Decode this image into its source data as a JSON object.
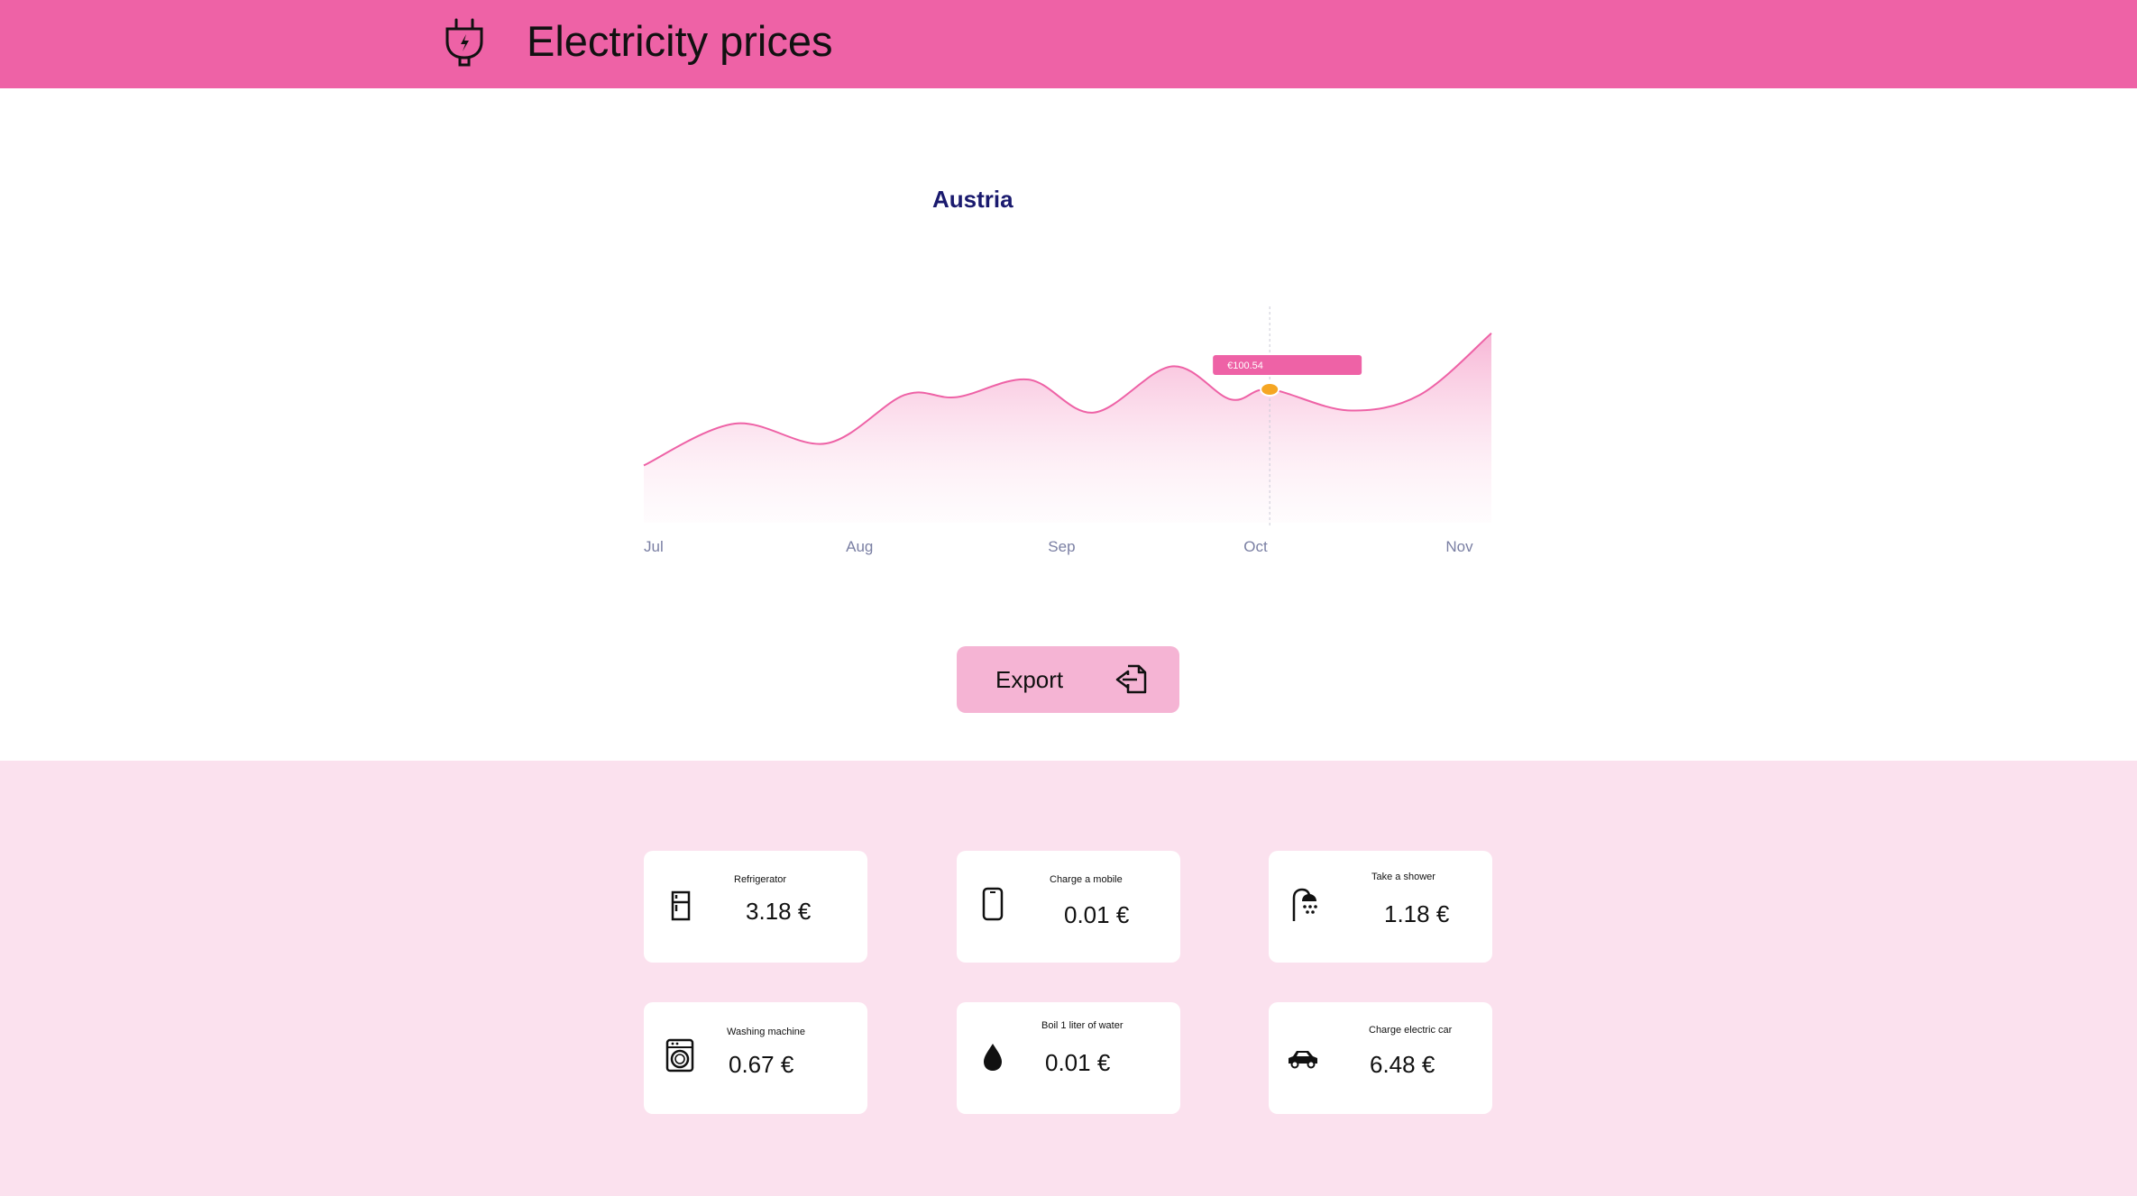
{
  "header": {
    "title": "Electricity prices",
    "icon": "plug-icon",
    "background": "#ee62a6"
  },
  "chart_section": {
    "title": "Austria",
    "tooltip": "€100.54",
    "export_label": "Export"
  },
  "chart_data": {
    "type": "area",
    "title": "Austria",
    "x_ticks": [
      "Jul",
      "Aug",
      "Sep",
      "Oct",
      "Nov"
    ],
    "x": [
      "Jul 1",
      "Jul 15",
      "Jul 29",
      "Aug 10",
      "Aug 18",
      "Aug 29",
      "Sep 8",
      "Sep 20",
      "Sep 29",
      "Oct 5",
      "Oct 17",
      "Oct 28",
      "Nov 8"
    ],
    "values": [
      66,
      85,
      76,
      98,
      97,
      105,
      90,
      111,
      96,
      100.54,
      91,
      98,
      126
    ],
    "highlight": {
      "x": "Oct 5",
      "value": 100.54
    },
    "ylim": [
      40,
      130
    ],
    "colors": {
      "line": "#ee62a6",
      "fill": "#f7b3d4",
      "marker": "#f5a623"
    }
  },
  "cards": [
    {
      "label": "Refrigerator",
      "value": "3.18 €",
      "icon": "refrigerator-icon"
    },
    {
      "label": "Charge a mobile",
      "value": "0.01 €",
      "icon": "mobile-phone-icon"
    },
    {
      "label": "Take a shower",
      "value": "1.18 €",
      "icon": "shower-icon"
    },
    {
      "label": "Washing machine",
      "value": "0.67 €",
      "icon": "washing-machine-icon"
    },
    {
      "label": "Boil 1 liter of water",
      "value": "0.01 €",
      "icon": "water-drop-icon"
    },
    {
      "label": "Charge electric car",
      "value": "6.48 €",
      "icon": "car-icon"
    }
  ]
}
